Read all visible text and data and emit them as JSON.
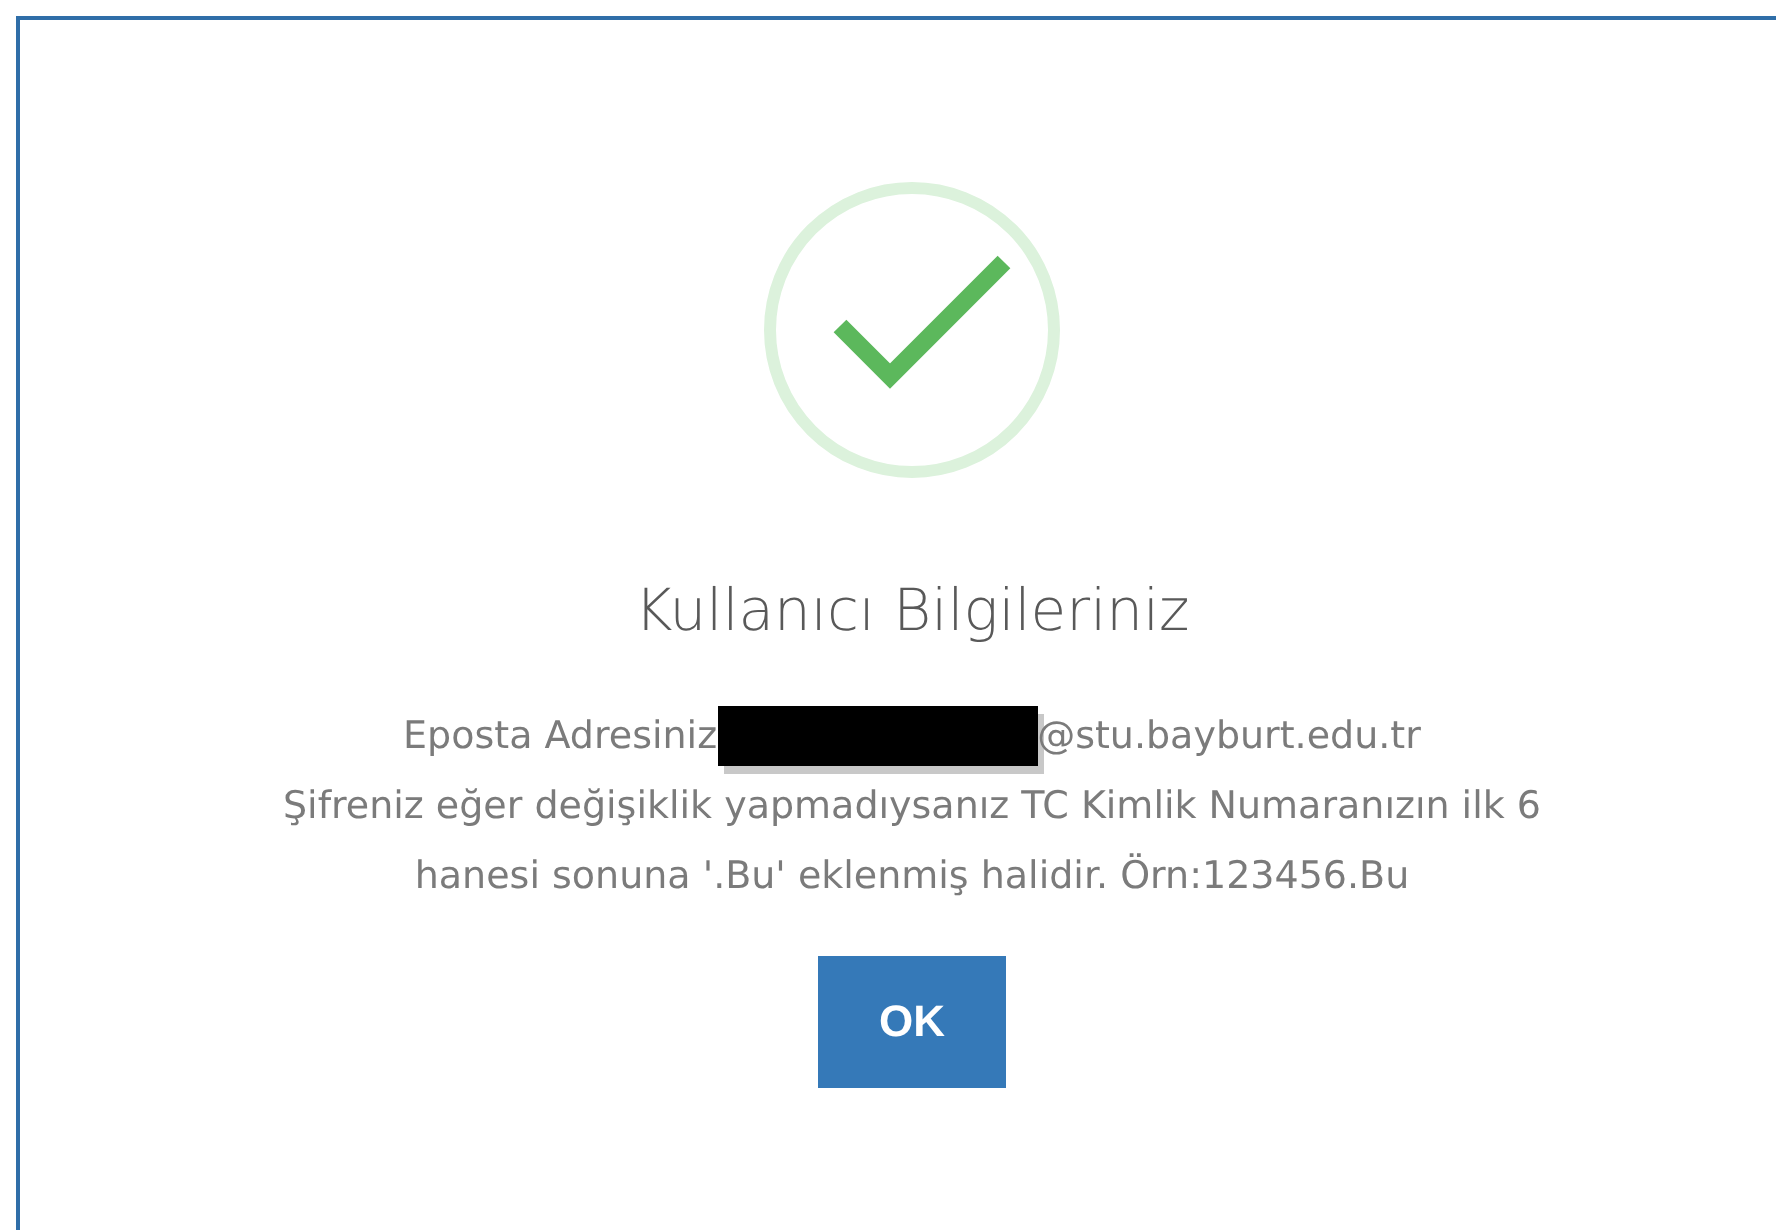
{
  "dialog": {
    "title": "Kullanıcı Bilgileriniz",
    "email_line": {
      "label": "Eposta Adresiniz",
      "redacted": true,
      "suffix": "@stu.bayburt.edu.tr"
    },
    "message": "Şifreniz eğer değişiklik yapmadıysanız TC Kimlik Numaranızın ilk 6 hanesi sonuna '.Bu' eklenmiş halidir. Örn:123456.Bu",
    "buttons": [
      {
        "label": "OK"
      }
    ]
  }
}
